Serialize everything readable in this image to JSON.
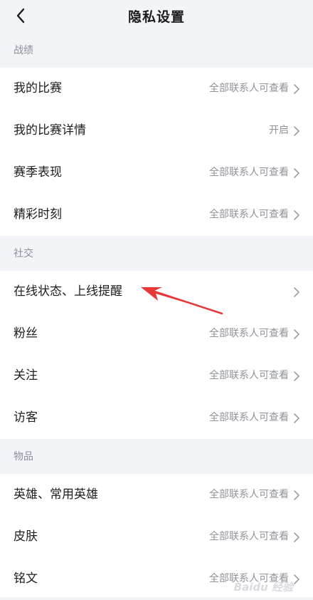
{
  "header": {
    "title": "隐私设置",
    "back_icon": "chevron-left-icon"
  },
  "sections": [
    {
      "title": "战绩",
      "items": [
        {
          "label": "我的比赛",
          "value": "全部联系人可查看"
        },
        {
          "label": "我的比赛详情",
          "value": "开启"
        },
        {
          "label": "赛季表现",
          "value": "全部联系人可查看"
        },
        {
          "label": "精彩时刻",
          "value": "全部联系人可查看"
        }
      ]
    },
    {
      "title": "社交",
      "items": [
        {
          "label": "在线状态、上线提醒",
          "value": ""
        },
        {
          "label": "粉丝",
          "value": "全部联系人可查看"
        },
        {
          "label": "关注",
          "value": "全部联系人可查看"
        },
        {
          "label": "访客",
          "value": "全部联系人可查看"
        }
      ]
    },
    {
      "title": "物品",
      "items": [
        {
          "label": "英雄、常用英雄",
          "value": "全部联系人可查看"
        },
        {
          "label": "皮肤",
          "value": "全部联系人可查看"
        },
        {
          "label": "铭文",
          "value": "全部联系人可查看"
        }
      ]
    }
  ],
  "watermark": "Baidu 经验",
  "colors": {
    "background": "#f2f4f8",
    "row": "#ffffff",
    "value_text": "#8f9399",
    "annotation_arrow": "#e8383a"
  }
}
